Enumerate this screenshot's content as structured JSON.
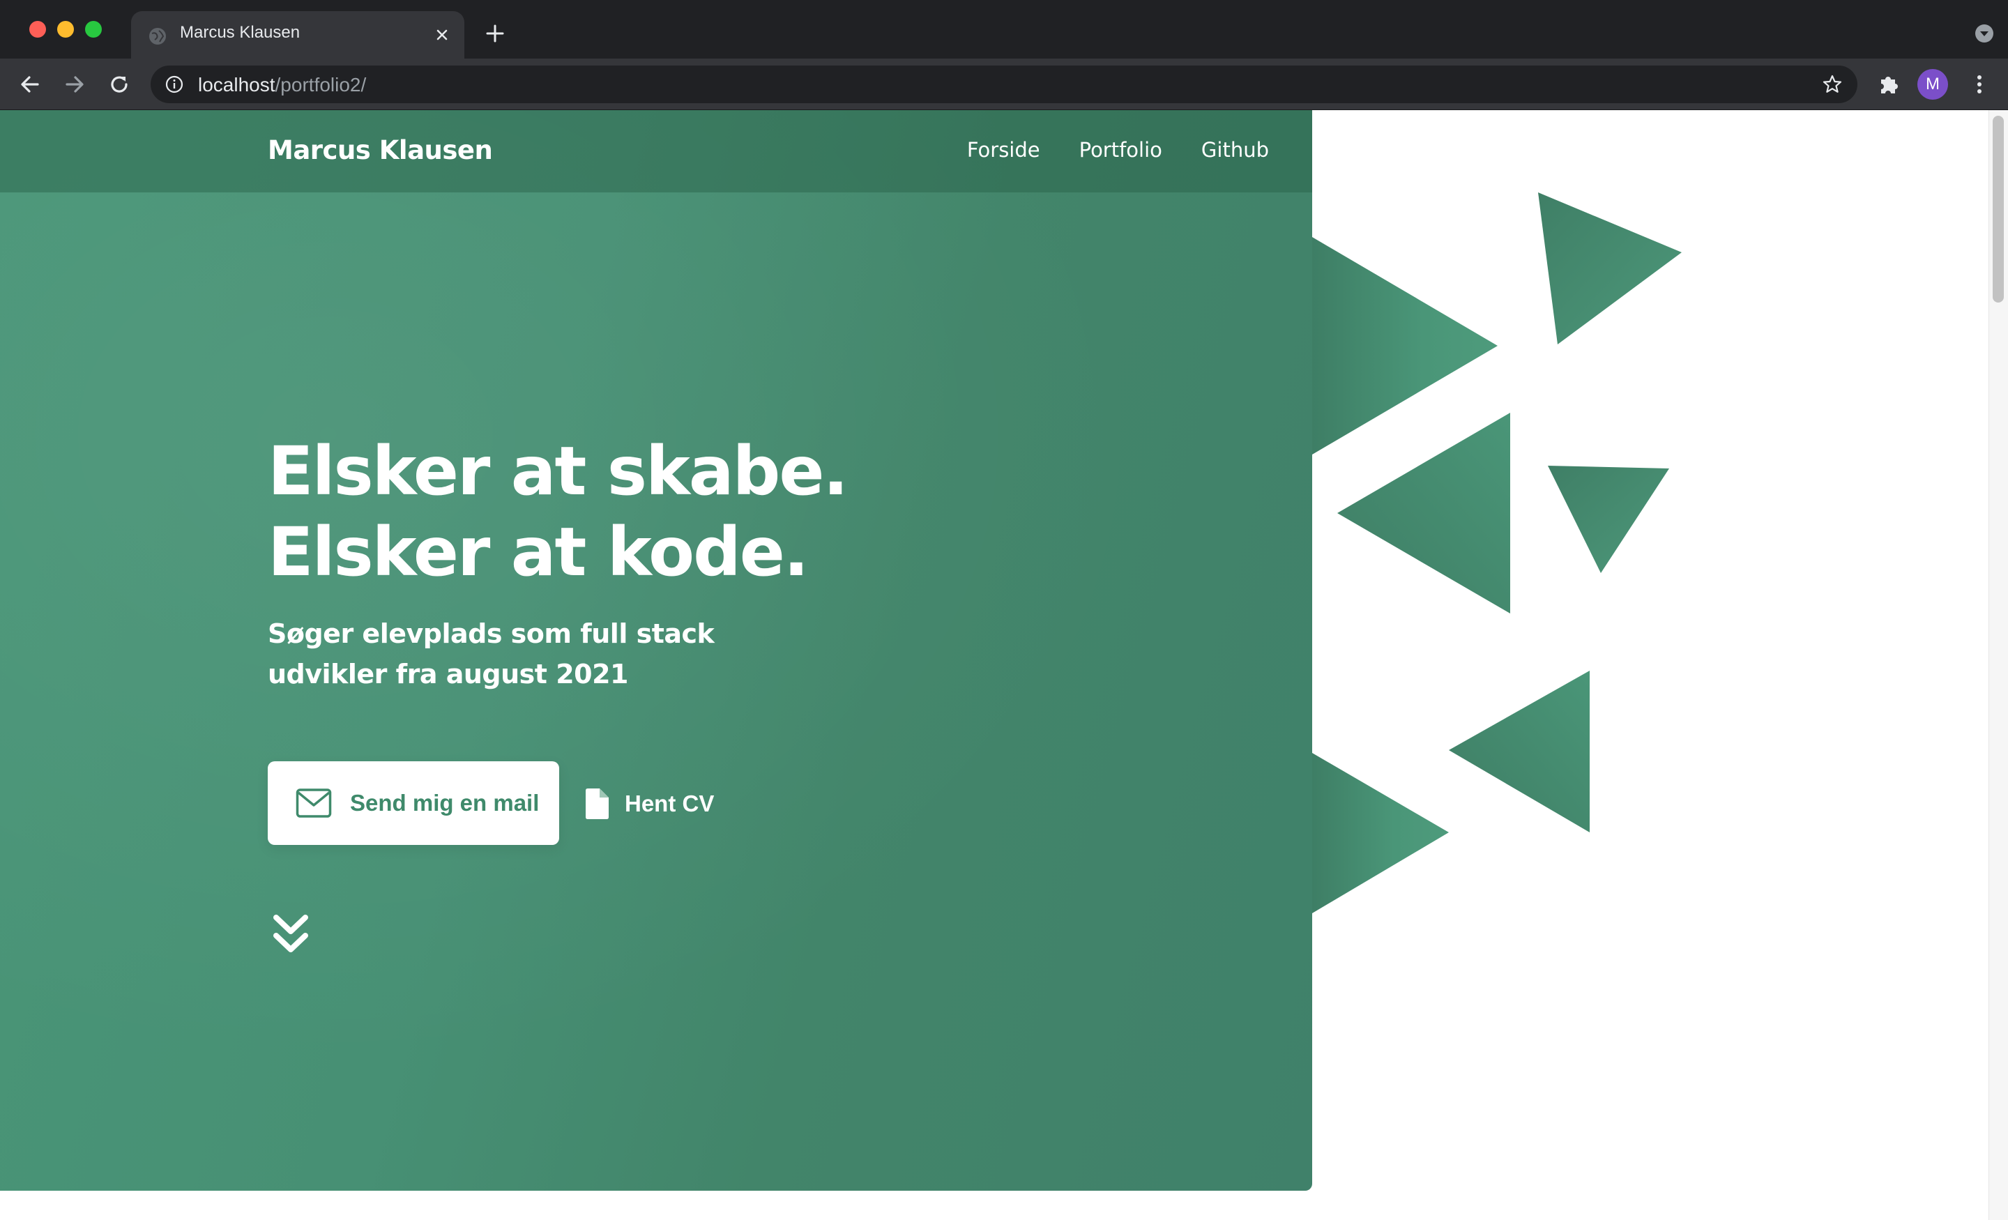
{
  "browser": {
    "tab_title": "Marcus Klausen",
    "url_host": "localhost",
    "url_path": "/portfolio2/",
    "profile_initial": "M"
  },
  "site": {
    "brand": "Marcus Klausen",
    "nav": [
      "Forside",
      "Portfolio",
      "Github"
    ],
    "headline_line1": "Elsker at skabe.",
    "headline_line2": "Elsker at kode.",
    "subline": "Søger elevplads som full stack udvikler fra august 2021",
    "mail_button": "Send mig en mail",
    "cv_button": "Hent CV"
  },
  "colors": {
    "accent_green": "#479074",
    "mail_button_text": "#3f8a6b",
    "chrome_dark": "#202124",
    "avatar": "#7b4fc9"
  },
  "icons": [
    "globe-icon",
    "close-icon",
    "plus-icon",
    "arrow-left-icon",
    "arrow-right-icon",
    "reload-icon",
    "info-icon",
    "star-icon",
    "puzzle-icon",
    "more-vert-icon",
    "envelope-icon",
    "file-icon",
    "double-chevron-down-icon"
  ]
}
